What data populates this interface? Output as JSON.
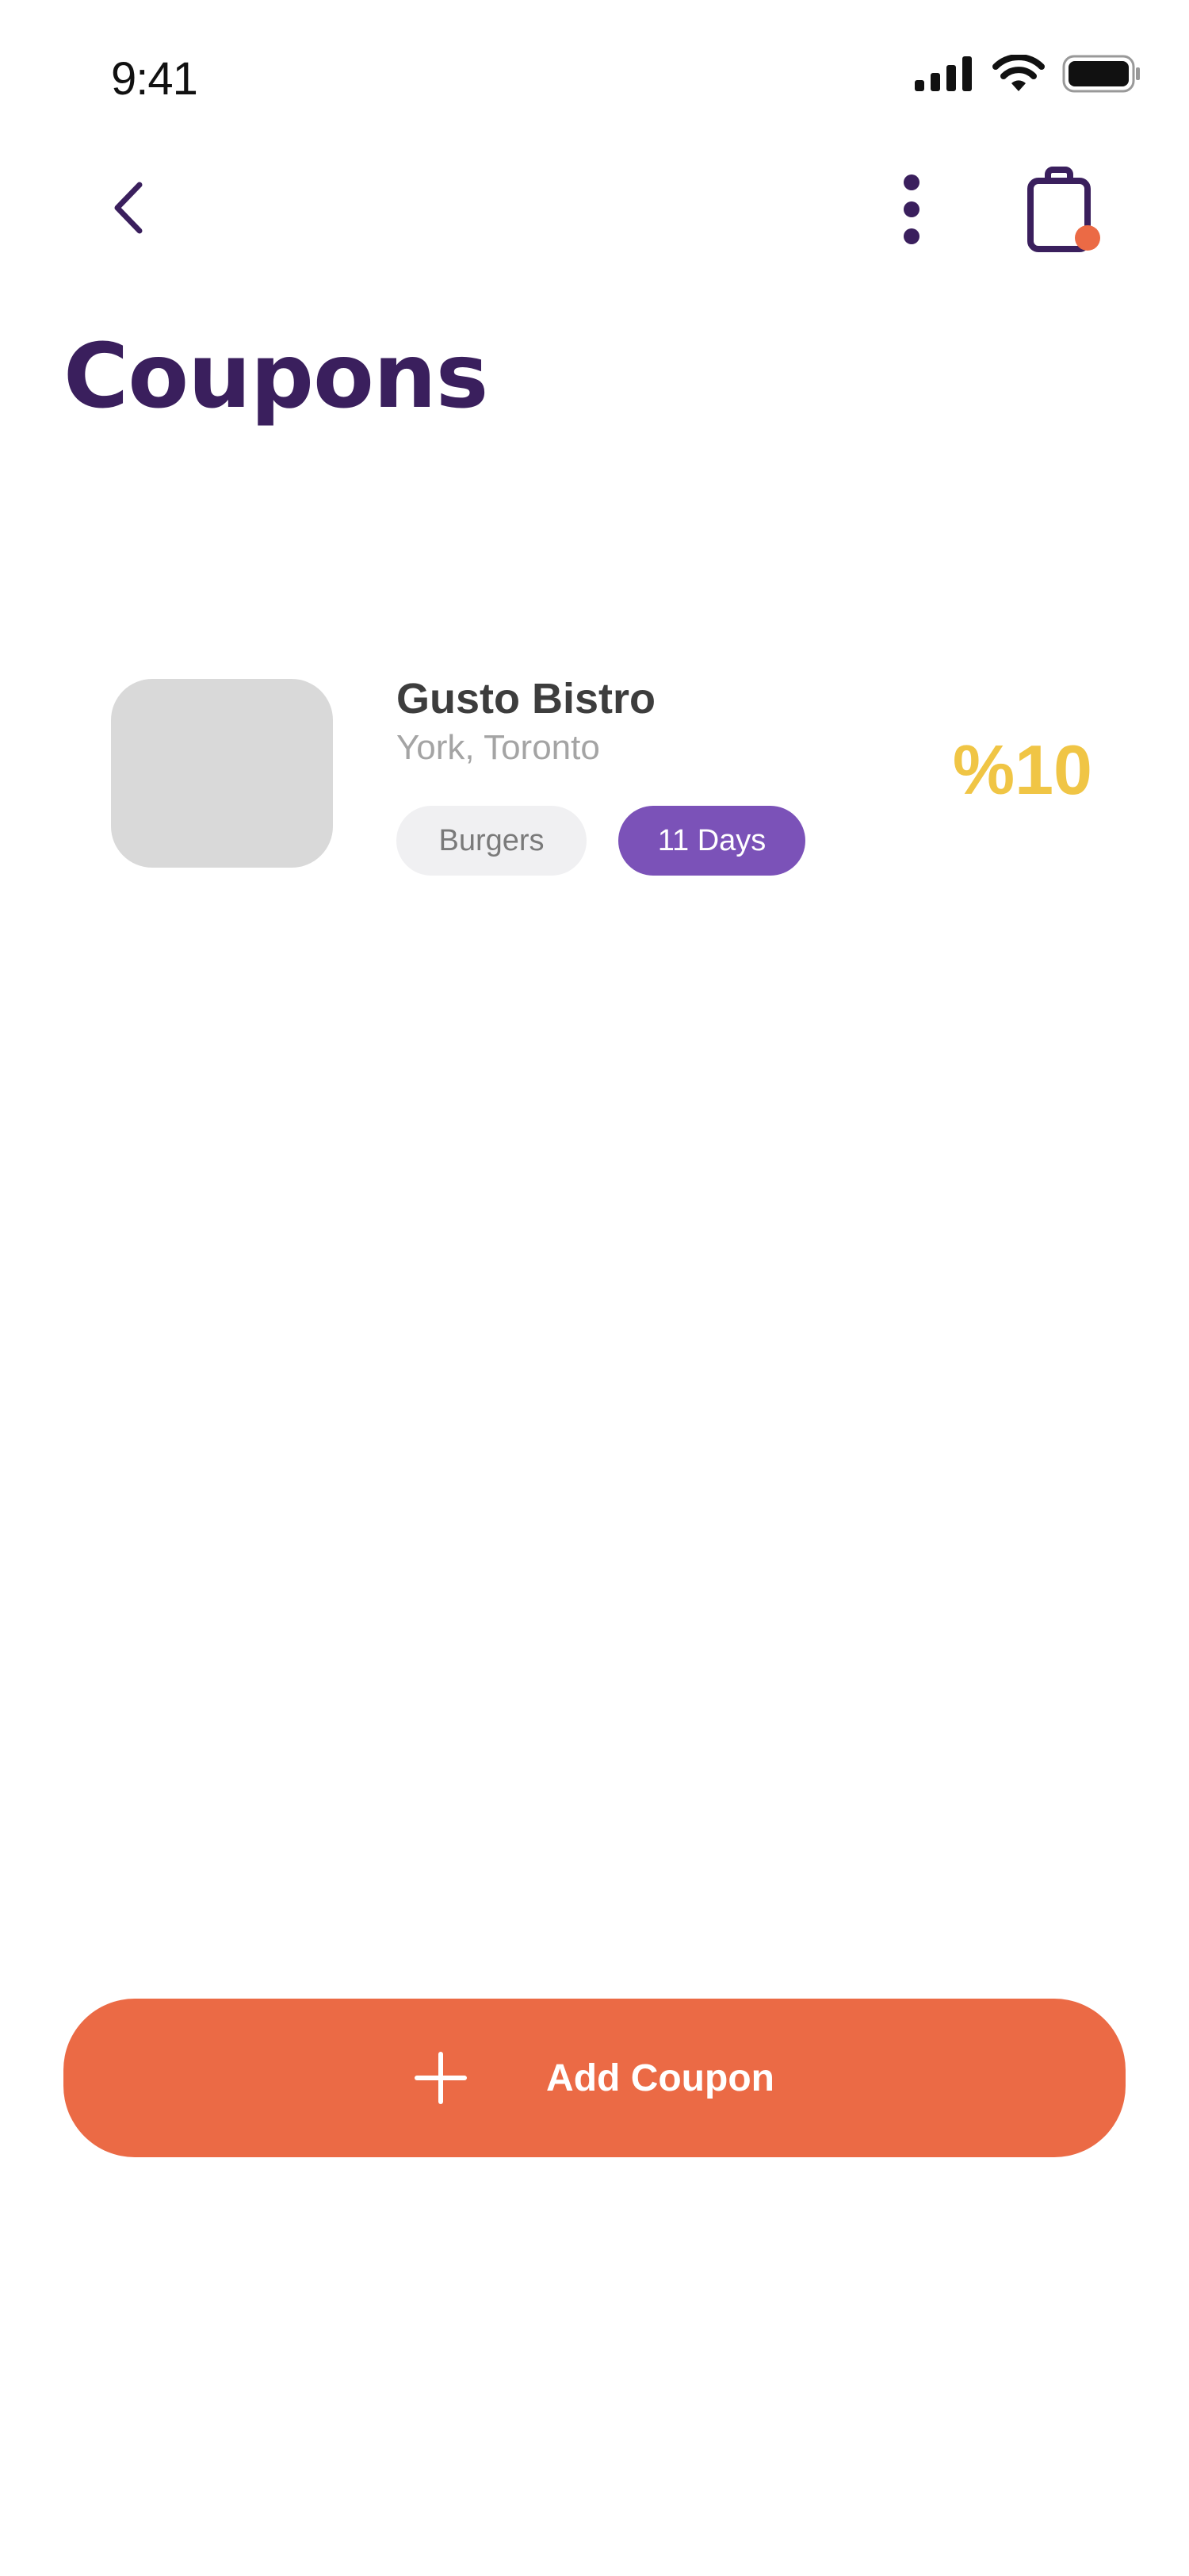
{
  "status_bar": {
    "time": "9:41"
  },
  "header": {
    "back_icon": "chevron-left-icon",
    "more_icon": "more-vertical-icon",
    "bag_icon": "shopping-bag-icon",
    "bag_has_notification": true
  },
  "page": {
    "title": "Coupons"
  },
  "coupons": [
    {
      "name": "Gusto Bistro",
      "location": "York, Toronto",
      "category": "Burgers",
      "validity": "11 Days",
      "discount": "%10"
    }
  ],
  "actions": {
    "add_coupon_label": "Add Coupon",
    "add_icon": "plus-icon"
  },
  "colors": {
    "title": "#3a1f5d",
    "accent_orange": "#eb6a45",
    "accent_purple": "#7b52b8",
    "discount_yellow": "#f0c545",
    "thumbnail_placeholder": "#d9d9d9"
  }
}
